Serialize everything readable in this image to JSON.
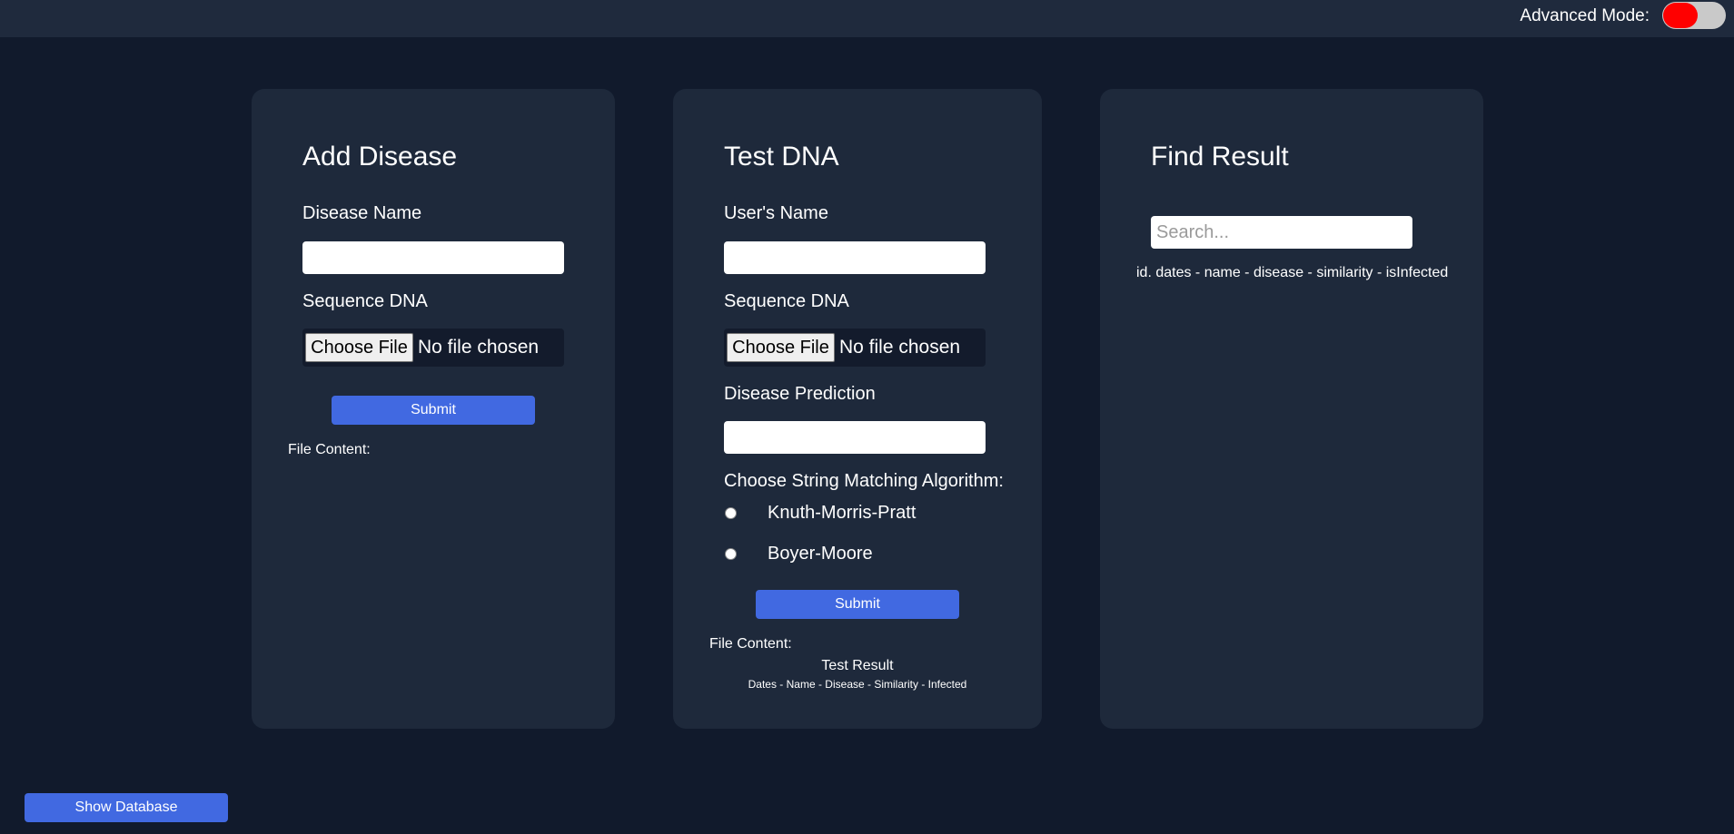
{
  "header": {
    "advanced_mode_label": "Advanced Mode:",
    "advanced_mode_on": false,
    "toggle_color": "#ff0000"
  },
  "add_disease": {
    "title": "Add Disease",
    "disease_name_label": "Disease Name",
    "disease_name_value": "",
    "sequence_label": "Sequence DNA",
    "choose_file_label": "Choose File",
    "file_status": "No file chosen",
    "submit_label": "Submit",
    "file_content_label": "File Content:"
  },
  "test_dna": {
    "title": "Test DNA",
    "user_name_label": "User's Name",
    "user_name_value": "",
    "sequence_label": "Sequence DNA",
    "choose_file_label": "Choose File",
    "file_status": "No file chosen",
    "disease_prediction_label": "Disease Prediction",
    "disease_prediction_value": "",
    "algorithm_label": "Choose String Matching Algorithm:",
    "algorithms": [
      "Knuth-Morris-Pratt",
      "Boyer-Moore"
    ],
    "submit_label": "Submit",
    "file_content_label": "File Content:",
    "result_title": "Test Result",
    "result_columns": "Dates - Name - Disease - Similarity - Infected"
  },
  "find_result": {
    "title": "Find Result",
    "search_placeholder": "Search...",
    "search_value": "",
    "result_columns": "id. dates - name - disease - similarity - isInfected"
  },
  "footer": {
    "show_database_label": "Show Database"
  },
  "colors": {
    "background": "#111a2c",
    "card": "#1e293b",
    "accent": "#4169e1"
  }
}
